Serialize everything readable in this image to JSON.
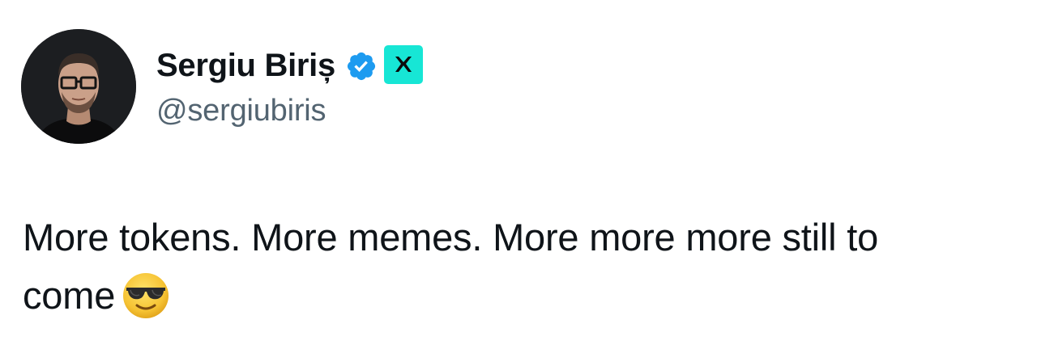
{
  "author": {
    "display_name": "Sergiu Biriș",
    "handle": "@sergiubiris",
    "verified_icon": "verified-checkmark-icon",
    "affiliate_icon": "x-logo-icon",
    "verified_color": "#1d9bf0",
    "affiliate_color": "#17e6d5"
  },
  "tweet": {
    "text_part1": "More tokens. More memes. More more more still to",
    "text_part2": "come",
    "emoji_icon": "smiling-face-with-sunglasses-icon"
  },
  "colors": {
    "primary_text": "#0f1419",
    "secondary_text": "#536471"
  }
}
